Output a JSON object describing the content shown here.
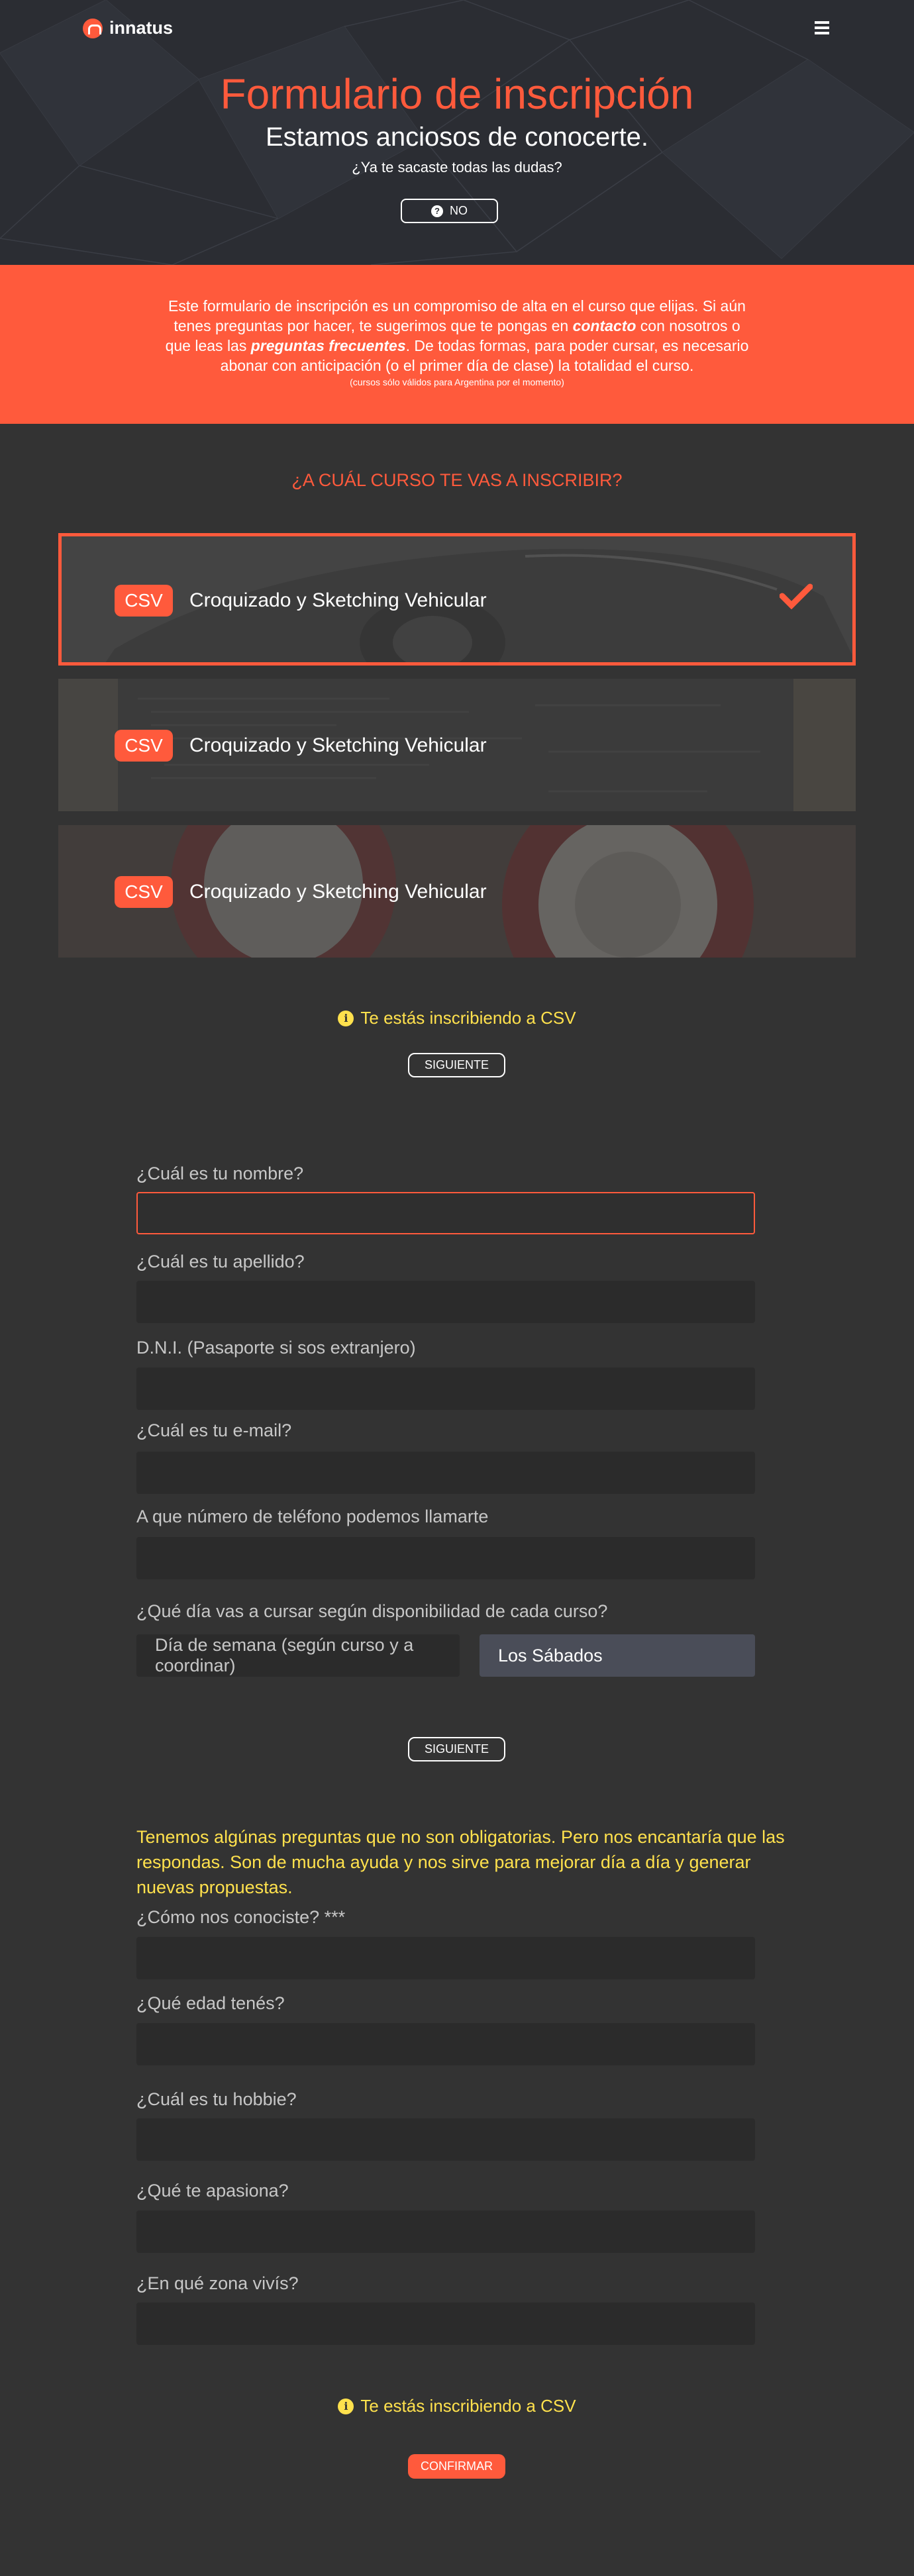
{
  "brand": {
    "name": "innatus",
    "accent": "#ff5a3c",
    "highlight": "#ffe14d"
  },
  "nav": {
    "menu_icon": "hamburger-menu-icon"
  },
  "hero": {
    "title": "Formulario de inscripción",
    "subtitle": "Estamos anciosos de conocerte.",
    "question": "¿Ya te sacaste todas las dudas?",
    "no_button": "NO",
    "no_icon": "question-circle-icon"
  },
  "intro": {
    "text_1": "Este formulario de inscripción es un compromiso de alta en el curso que elijas. Si aún tenes preguntas por hacer, te sugerimos que te pongas en ",
    "link_contact": "contacto",
    "text_2": " con nosotros o que leas las ",
    "link_faq": "preguntas frecuentes",
    "text_3": ". De todas formas, para poder cursar, es necesario abonar con anticipación (o el primer día de clase) la totalidad el curso.",
    "small": "(cursos sólo válidos para Argentina por el momento)"
  },
  "courses": {
    "title": "¿A CUÁL CURSO TE VAS A INSCRIBIR?",
    "items": [
      {
        "tag": "CSV",
        "name": "Croquizado y Sketching Vehicular",
        "selected": true
      },
      {
        "tag": "CSV",
        "name": "Croquizado y Sketching Vehicular",
        "selected": false
      },
      {
        "tag": "CSV",
        "name": "Croquizado y Sketching Vehicular",
        "selected": false
      }
    ],
    "selected_info": "Te estás inscribiendo a CSV",
    "next_button": "SIGUIENTE"
  },
  "form": {
    "nombre_label": "¿Cuál es tu nombre?",
    "apellido_label": "¿Cuál es tu apellido?",
    "dni_label": "D.N.I. (Pasaporte si sos extranjero)",
    "email_label": "¿Cuál es tu e-mail?",
    "telefono_label": "A que número de teléfono podemos llamarte",
    "dia_label": "¿Qué día vas a cursar según disponibilidad de cada curso?",
    "dia_options": [
      "Día de semana (según curso y a coordinar)",
      "Los Sábados"
    ],
    "dia_selected": "Los Sábados",
    "next_button": "SIGUIENTE"
  },
  "optional": {
    "note": "Tenemos algúnas preguntas que no son obligatorias. Pero nos encantaría que las respondas. Son de mucha ayuda y nos sirve para mejorar día a día y generar nuevas propuestas.",
    "conociste_label": "¿Cómo nos conociste? ***",
    "edad_label": "¿Qué edad tenés?",
    "hobbie_label": "¿Cuál es tu hobbie?",
    "apasiona_label": "¿Qué te apasiona?",
    "zona_label": "¿En qué zona vivís?",
    "selected_info": "Te estás inscribiendo a CSV",
    "confirm_button": "CONFIRMAR"
  }
}
